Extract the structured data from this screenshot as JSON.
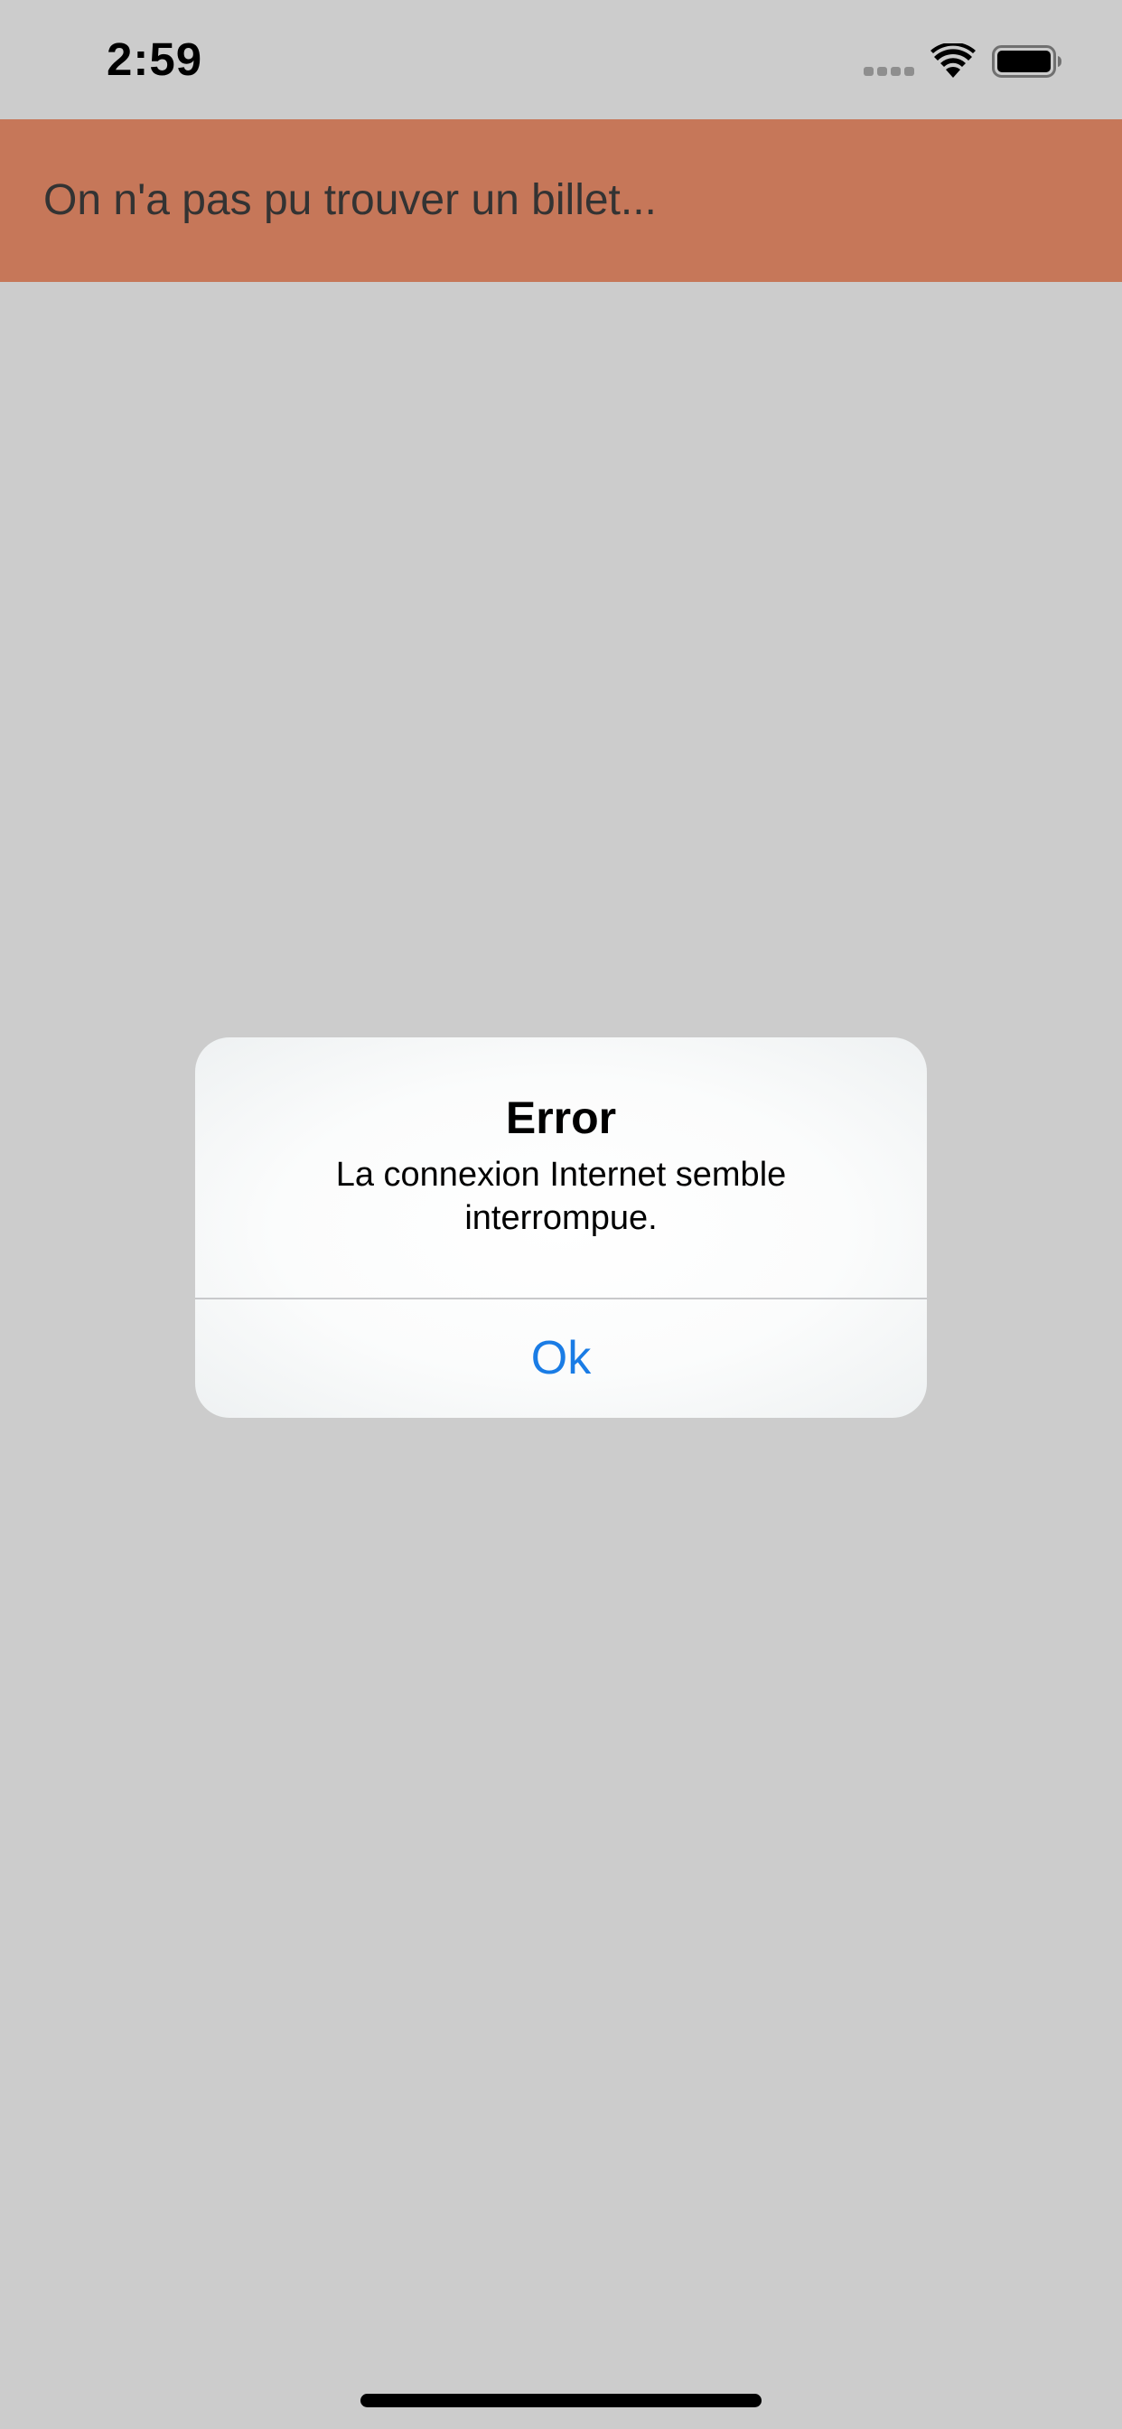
{
  "status_bar": {
    "time": "2:59",
    "icons": [
      "signal-dots-icon",
      "wifi-icon",
      "battery-icon"
    ]
  },
  "banner": {
    "text": "On n'a pas pu trouver un billet...",
    "color": "#c67759"
  },
  "alert": {
    "title": "Error",
    "message": "La connexion Internet semble interrompue.",
    "ok_label": "Ok",
    "button_color": "#1a7ce5"
  },
  "colors": {
    "background": "#cccccc"
  }
}
